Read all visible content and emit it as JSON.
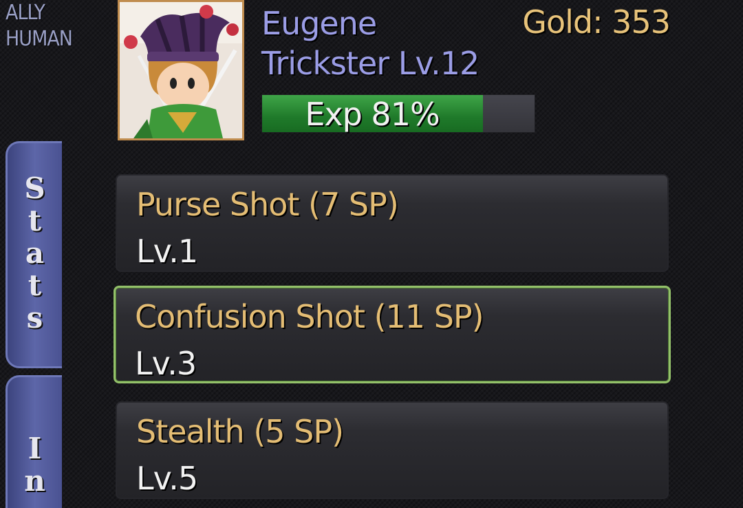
{
  "header": {
    "class_tag_line1": "ALLY",
    "class_tag_line2": "HUMAN",
    "name": "Eugene",
    "job": "Trickster Lv.12",
    "gold": "Gold: 353",
    "exp_label": "Exp 81%",
    "exp_fraction": 0.81
  },
  "tabs": {
    "stats": "Stats",
    "inventory": "In"
  },
  "skills": [
    {
      "name": "Purse Shot (7 SP)",
      "level": "Lv.1",
      "selected": false
    },
    {
      "name": "Confusion Shot (11 SP)",
      "level": "Lv.3",
      "selected": true
    },
    {
      "name": "Stealth (5 SP)",
      "level": "Lv.5",
      "selected": false
    }
  ],
  "icons": {
    "portrait": "jester-portrait-icon"
  },
  "colors": {
    "name": "#9b9de6",
    "gold": "#e8c37a",
    "skill_name": "#e4bd74",
    "exp_fill": "#1f7a2a",
    "selected_border": "#93c06a"
  }
}
